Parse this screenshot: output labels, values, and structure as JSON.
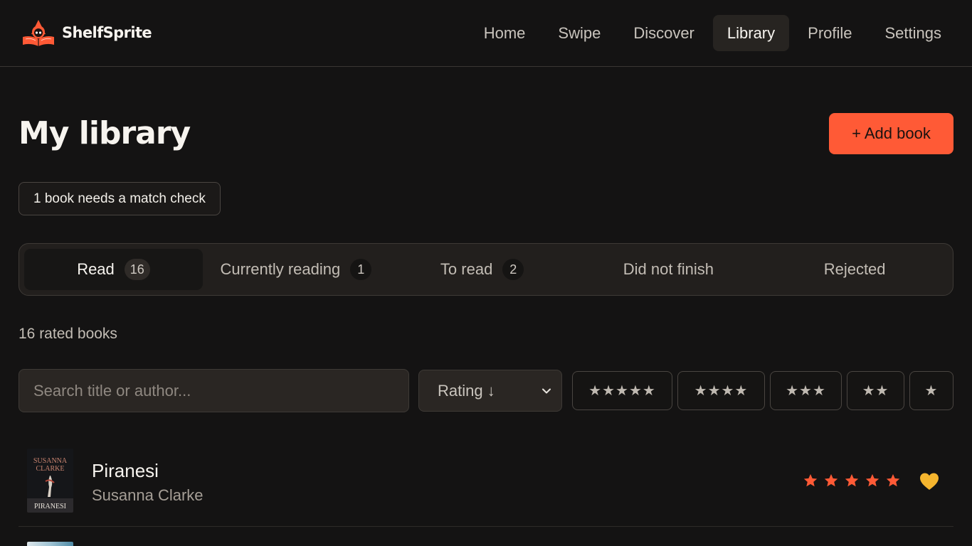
{
  "app": {
    "name": "ShelfSprite"
  },
  "nav": {
    "items": [
      {
        "label": "Home"
      },
      {
        "label": "Swipe"
      },
      {
        "label": "Discover"
      },
      {
        "label": "Library",
        "active": true
      },
      {
        "label": "Profile"
      },
      {
        "label": "Settings"
      }
    ]
  },
  "page": {
    "title": "My library",
    "add_label": "+ Add book",
    "match_notice": "1 book needs a match check",
    "rated_count": "16 rated books"
  },
  "tabs": [
    {
      "label": "Read",
      "count": "16",
      "active": true
    },
    {
      "label": "Currently reading",
      "count": "1"
    },
    {
      "label": "To read",
      "count": "2"
    },
    {
      "label": "Did not finish"
    },
    {
      "label": "Rejected"
    }
  ],
  "filters": {
    "search_placeholder": "Search title or author...",
    "sort_value": "Rating ↓",
    "star_filters": [
      "★★★★★",
      "★★★★",
      "★★★",
      "★★",
      "★"
    ]
  },
  "books": [
    {
      "title": "Piranesi",
      "author": "Susanna Clarke",
      "rating": 5,
      "favorite": true,
      "cover_author": "SUSANNA CLARKE",
      "cover_title": "PIRANESI"
    }
  ],
  "colors": {
    "accent": "#ff5a36",
    "background": "#141313",
    "star": "#ff5a36",
    "heart": "#f5b52e"
  },
  "icons": {
    "logo": "hooded-sprite-with-book-icon",
    "sort": "chevron-down-icon",
    "favorite": "heart-icon",
    "rating": "star-icon"
  }
}
